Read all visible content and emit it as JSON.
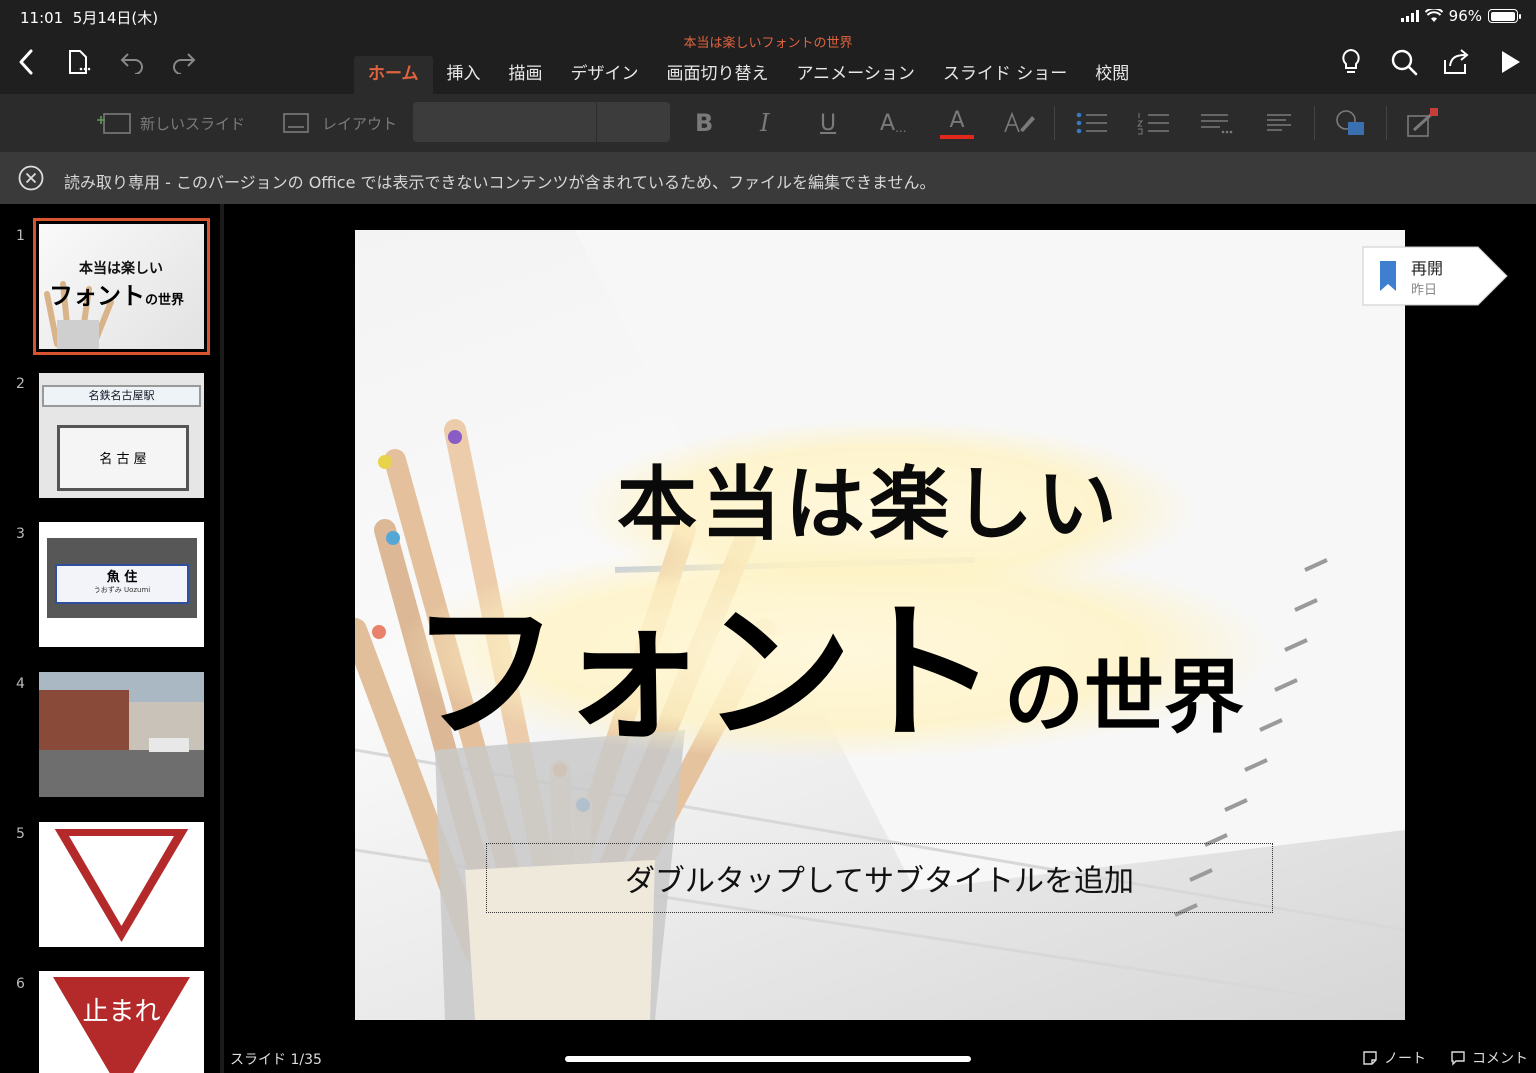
{
  "status": {
    "time": "11:01",
    "date": "5月14日(木)",
    "battery": "96%"
  },
  "app": {
    "doc_title": "本当は楽しいフォントの世界"
  },
  "tabs": [
    {
      "label": "ホーム",
      "active": true
    },
    {
      "label": "挿入"
    },
    {
      "label": "描画"
    },
    {
      "label": "デザイン"
    },
    {
      "label": "画面切り替え"
    },
    {
      "label": "アニメーション"
    },
    {
      "label": "スライド ショー"
    },
    {
      "label": "校閲"
    }
  ],
  "ribbon": {
    "new_slide": "新しいスライド",
    "layout": "レイアウト",
    "bold": "B",
    "italic": "I",
    "underline": "U",
    "font_size": "A",
    "font_color": "A"
  },
  "notice": {
    "text": "読み取り専用 - このバージョンの Office では表示できないコンテンツが含まれているため、ファイルを編集できません。"
  },
  "thumbnails": [
    {
      "num": "1",
      "line1": "本当は楽しい",
      "line2": "フォント",
      "line2b": "の世界"
    },
    {
      "num": "2",
      "sign_top": "名鉄名古屋駅",
      "sign_bottom": "名 古 屋"
    },
    {
      "num": "3",
      "sign": "魚 住",
      "sign_sub": "うおずみ Uozumi"
    },
    {
      "num": "4"
    },
    {
      "num": "5"
    },
    {
      "num": "6",
      "sign": "止まれ"
    }
  ],
  "slide": {
    "title_line1": "本当は楽しい",
    "title_line2": "フォント",
    "title_line2_suffix": "の世界",
    "subtitle_placeholder": "ダブルタップしてサブタイトルを追加"
  },
  "resume": {
    "title": "再開",
    "subtitle": "昨日"
  },
  "footer": {
    "slide_counter": "スライド 1/35",
    "notes": "ノート",
    "comments": "コメント"
  },
  "colors": {
    "accent": "#e0633f",
    "selection": "#d9532f",
    "stop_sign": "#b42a2a"
  }
}
